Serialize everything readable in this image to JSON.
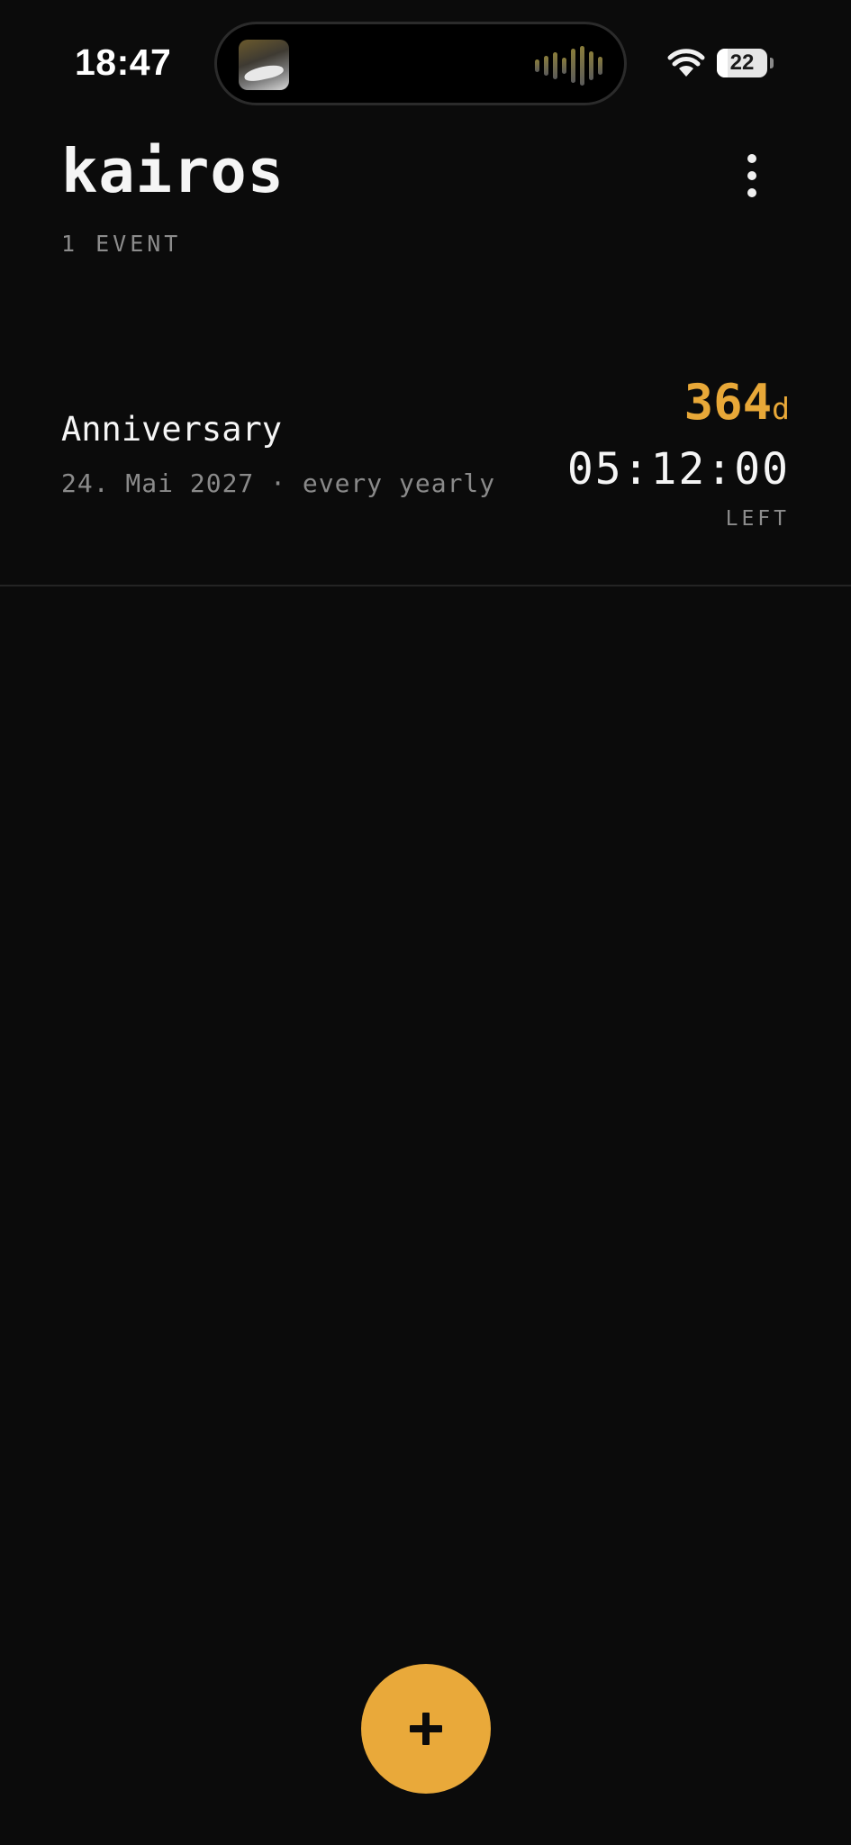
{
  "status_bar": {
    "time": "18:47",
    "battery_level": "22",
    "battery_fraction": 0.22,
    "icons": [
      "now-playing-art-icon",
      "waveform-icon",
      "wifi-icon",
      "battery-icon"
    ]
  },
  "header": {
    "title": "kairos",
    "subtitle": "1 EVENT",
    "menu_icon": "more-vertical-icon"
  },
  "events": [
    {
      "name": "Anniversary",
      "meta": "24. Mai 2027 · every yearly",
      "days_value": "364",
      "days_unit": "d",
      "time_left": "05:12:00",
      "left_label": "LEFT"
    }
  ],
  "fab": {
    "icon": "plus-icon"
  },
  "colors": {
    "background": "#0b0b0b",
    "accent": "#e9a93a",
    "text_primary": "#f5f5f5",
    "text_secondary": "#8c8c8c",
    "divider": "#242424"
  }
}
